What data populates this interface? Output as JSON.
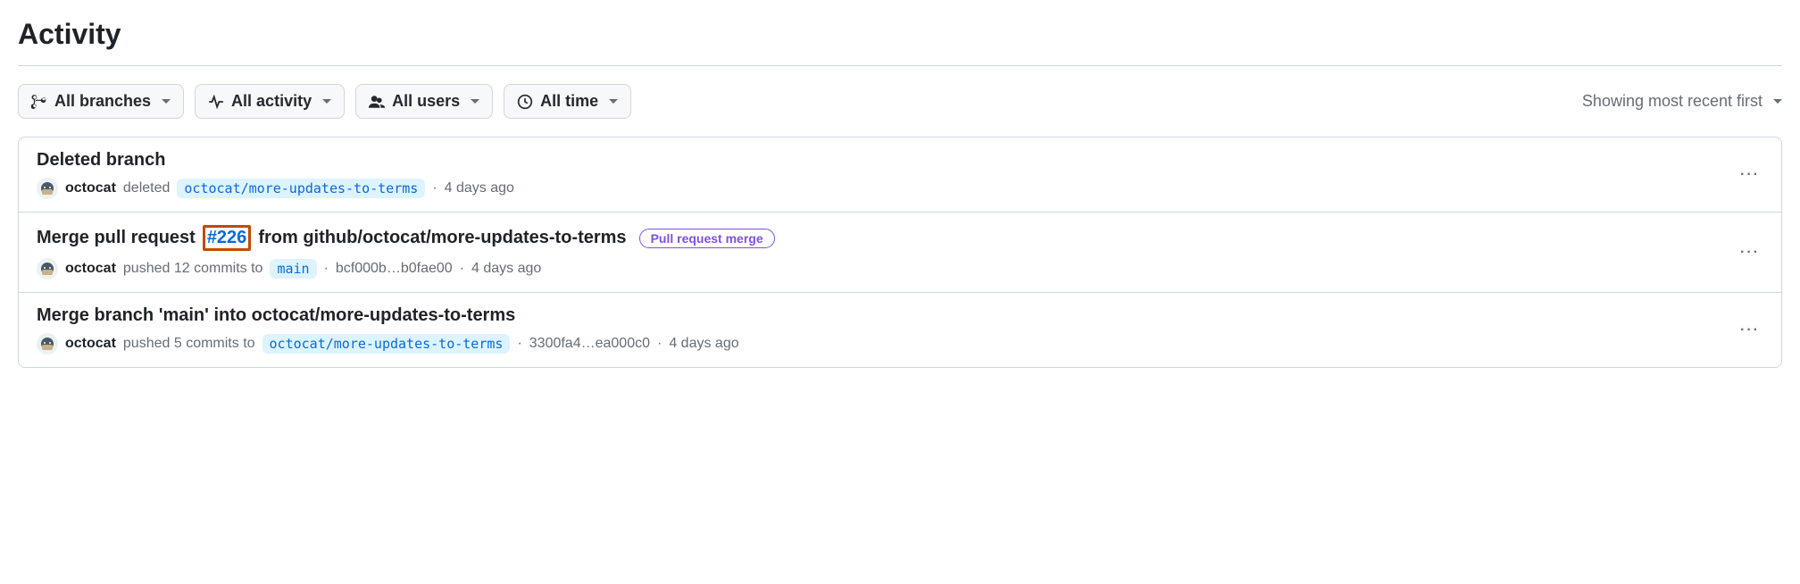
{
  "header": {
    "title": "Activity"
  },
  "filters": {
    "branches": "All branches",
    "activity": "All activity",
    "users": "All users",
    "time": "All time"
  },
  "sort": {
    "label": "Showing most recent first"
  },
  "rows": [
    {
      "title": "Deleted branch",
      "user": "octocat",
      "action": "deleted",
      "branch": "octocat/more-updates-to-terms",
      "time": "4 days ago"
    },
    {
      "title_prefix": "Merge pull request",
      "pr_number": "#226",
      "title_suffix": "from github/octocat/more-updates-to-terms",
      "badge": "Pull request merge",
      "user": "octocat",
      "action": "pushed 12 commits to",
      "branch": "main",
      "hash": "bcf000b…b0fae00",
      "time": "4 days ago"
    },
    {
      "title": "Merge branch 'main' into octocat/more-updates-to-terms",
      "user": "octocat",
      "action": "pushed 5 commits to",
      "branch": "octocat/more-updates-to-terms",
      "hash": "3300fa4…ea000c0",
      "time": "4 days ago"
    }
  ]
}
